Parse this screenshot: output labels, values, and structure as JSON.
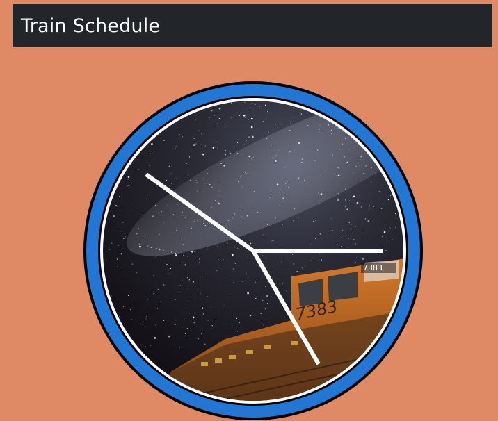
{
  "header": {
    "title": "Train Schedule"
  },
  "clock": {
    "background_image": "night-sky-with-locomotive",
    "train_number": "7383",
    "hands": [
      "hour-hand",
      "minute-hand",
      "second-hand"
    ]
  },
  "colors": {
    "page_background": "#e08a65",
    "header_background": "#222529",
    "header_text": "#ffffff",
    "clock_ring": "#2277d4",
    "clock_outline": "#000000",
    "clock_hands": "#ffffff",
    "locomotive": "#c96a22"
  }
}
